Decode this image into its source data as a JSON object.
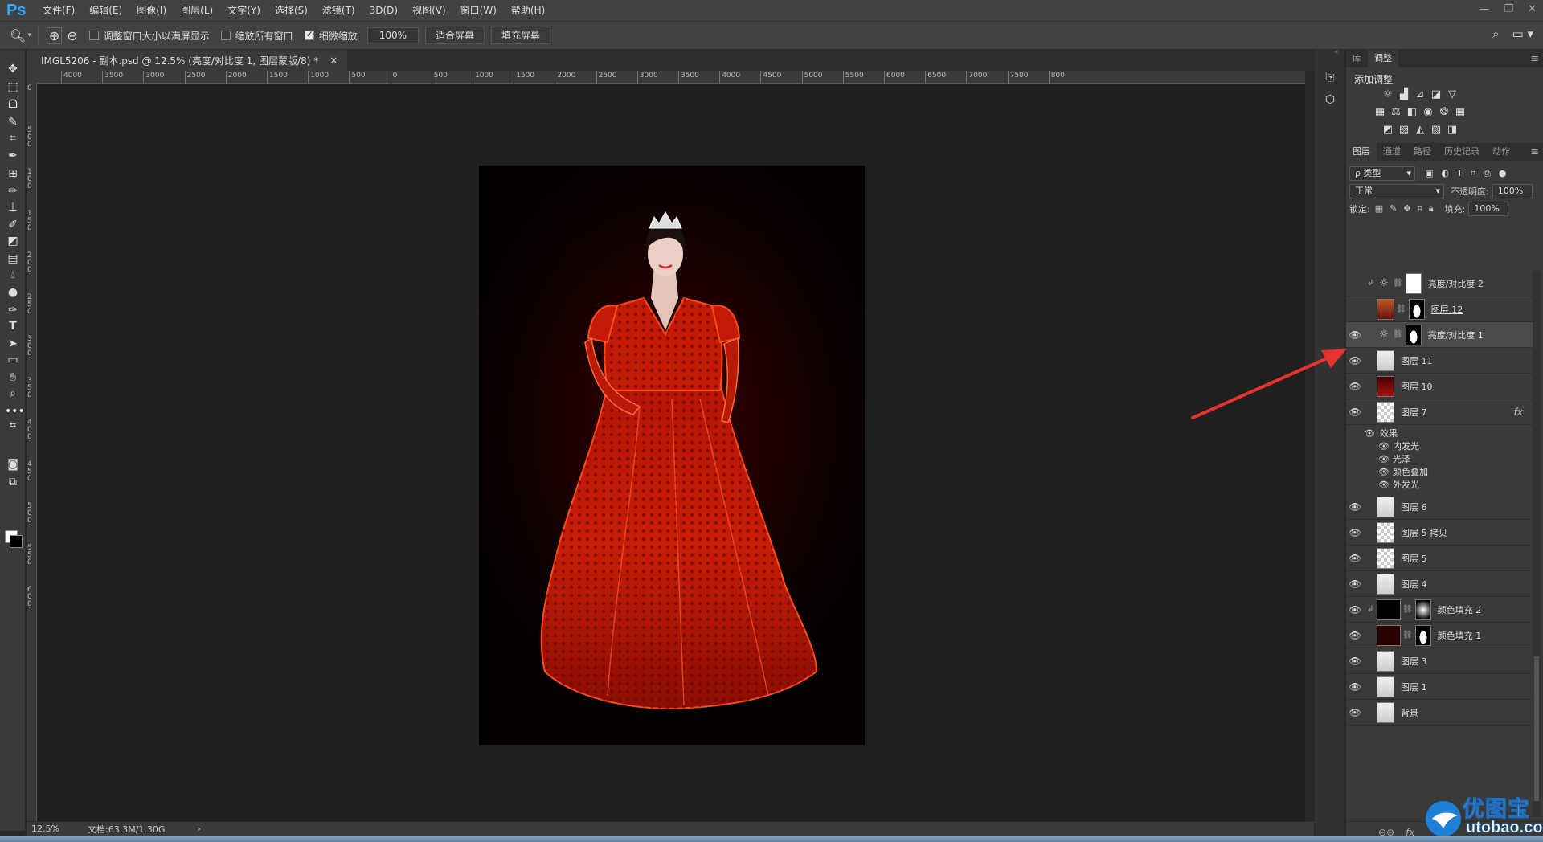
{
  "app": {
    "logo": "Ps",
    "menu": [
      "文件(F)",
      "编辑(E)",
      "图像(I)",
      "图层(L)",
      "文字(Y)",
      "选择(S)",
      "滤镜(T)",
      "3D(D)",
      "视图(V)",
      "窗口(W)",
      "帮助(H)"
    ]
  },
  "options": {
    "check_resize": "调整窗口大小以满屏显示",
    "check_resize_on": false,
    "check_all": "缩放所有窗口",
    "check_all_on": false,
    "check_scrubby": "细微缩放",
    "check_scrubby_on": true,
    "zoom_value": "100%",
    "fit_screen": "适合屏幕",
    "fill_screen": "填充屏幕"
  },
  "document": {
    "tab_title": "IMGL5206 - 副本.psd @ 12.5% (亮度/对比度 1, 图层蒙版/8) *",
    "close": "×"
  },
  "ruler": {
    "top_labels": [
      "4000",
      "3500",
      "3000",
      "2500",
      "2000",
      "1500",
      "1000",
      "500",
      "0",
      "500",
      "1000",
      "1500",
      "2000",
      "2500",
      "3000",
      "3500",
      "4000",
      "4500",
      "5000",
      "5500",
      "6000",
      "6500",
      "7000",
      "7500",
      "800"
    ],
    "left_labels": [
      "0",
      "5 0 0",
      "1 0 0",
      "1 5 0",
      "2 0 0",
      "2 5 0",
      "3 0 0",
      "3 5 0",
      "4 0 0",
      "4 5 0",
      "5 0 0",
      "5 5 0",
      "6 0 0"
    ]
  },
  "status": {
    "zoom": "12.5%",
    "doc": "文档:63.3M/1.30G",
    "arrow": "›"
  },
  "panels": {
    "top_tabs": [
      "库",
      "调整"
    ],
    "adj_title": "添加调整",
    "layer_tabs": [
      "图层",
      "通道",
      "路径",
      "历史记录",
      "动作"
    ],
    "kind_filter": "ρ 类型",
    "blend_mode": "正常",
    "opacity_label": "不透明度:",
    "opacity_value": "100%",
    "lock_label": "锁定:",
    "fill_label": "填充:",
    "fill_value": "100%"
  },
  "layers": [
    {
      "name": "亮度/对比度 2",
      "visible": false,
      "type": "adj",
      "mask": "white",
      "clip": true,
      "underline": false
    },
    {
      "name": "图层 12",
      "visible": false,
      "type": "pix",
      "thumb": "red",
      "mask": "silhouette",
      "underline": true
    },
    {
      "name": "亮度/对比度 1",
      "visible": true,
      "type": "adj",
      "mask": "silhouette",
      "selected": true
    },
    {
      "name": "图层 11",
      "visible": true,
      "type": "pix",
      "thumb": "dress-w"
    },
    {
      "name": "图层 10",
      "visible": true,
      "type": "pix",
      "thumb": "dress-r"
    },
    {
      "name": "图层 7",
      "visible": true,
      "type": "pix",
      "thumb": "checker",
      "fx": "fx"
    },
    {
      "name": "图层 6",
      "visible": true,
      "type": "pix",
      "thumb": "dress-w"
    },
    {
      "name": "图层 5 拷贝",
      "visible": true,
      "type": "pix",
      "thumb": "checker"
    },
    {
      "name": "图层 5",
      "visible": true,
      "type": "pix",
      "thumb": "checker"
    },
    {
      "name": "图层 4",
      "visible": true,
      "type": "pix",
      "thumb": "dress-w"
    },
    {
      "name": "颜色填充 2",
      "visible": true,
      "type": "fill",
      "thumb": "black",
      "mask": "radial",
      "clip": true
    },
    {
      "name": "颜色填充 1",
      "visible": true,
      "type": "fill",
      "thumb": "maroon",
      "mask": "silhouette",
      "underline": true
    },
    {
      "name": "图层 3",
      "visible": true,
      "type": "pix",
      "thumb": "dress-w"
    },
    {
      "name": "图层 1",
      "visible": true,
      "type": "pix",
      "thumb": "dress-w"
    },
    {
      "name": "背景",
      "visible": true,
      "type": "pix",
      "thumb": "dress-w"
    }
  ],
  "effects": {
    "title": "效果",
    "items": [
      "内发光",
      "光泽",
      "颜色叠加",
      "外发光"
    ]
  },
  "layers_bottom": [
    "⊖⊖",
    "fx",
    "◘",
    "◑",
    "▭",
    "▣",
    "🗑"
  ],
  "watermark": {
    "text": "优图宝",
    "url": "utobao.com"
  },
  "colors": {
    "accent_blue": "#31a8ff",
    "arrow_red": "#e8322d",
    "dress_red": "#c21a05"
  }
}
